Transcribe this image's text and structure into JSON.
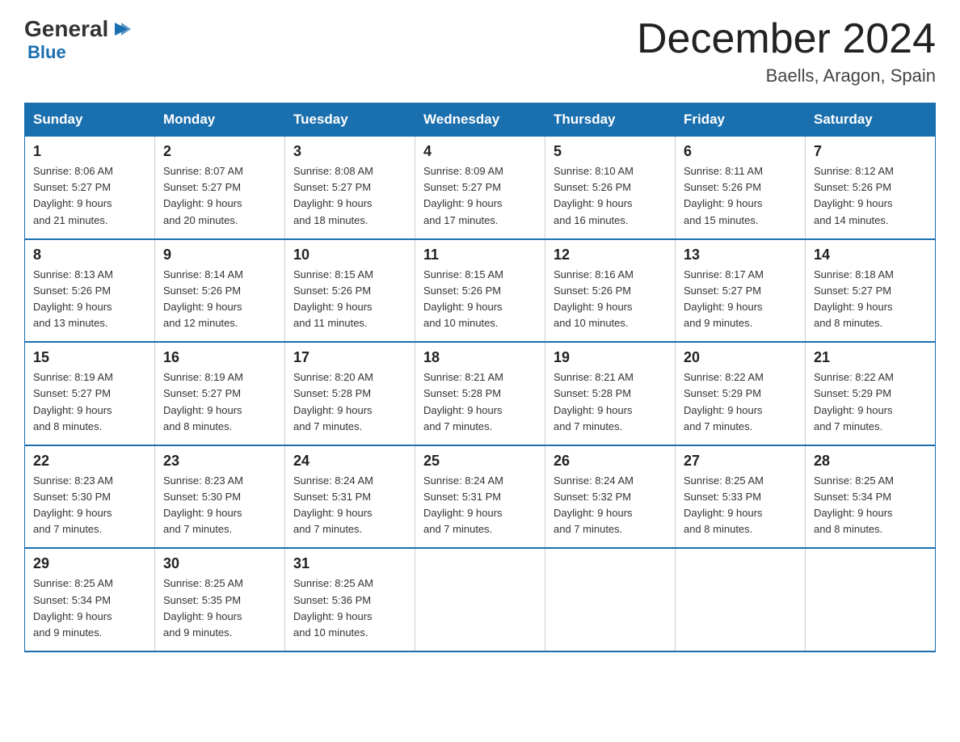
{
  "logo": {
    "general": "General",
    "blue": "Blue"
  },
  "title": "December 2024",
  "subtitle": "Baells, Aragon, Spain",
  "weekdays": [
    "Sunday",
    "Monday",
    "Tuesday",
    "Wednesday",
    "Thursday",
    "Friday",
    "Saturday"
  ],
  "weeks": [
    [
      {
        "day": "1",
        "sunrise": "8:06 AM",
        "sunset": "5:27 PM",
        "daylight": "9 hours and 21 minutes."
      },
      {
        "day": "2",
        "sunrise": "8:07 AM",
        "sunset": "5:27 PM",
        "daylight": "9 hours and 20 minutes."
      },
      {
        "day": "3",
        "sunrise": "8:08 AM",
        "sunset": "5:27 PM",
        "daylight": "9 hours and 18 minutes."
      },
      {
        "day": "4",
        "sunrise": "8:09 AM",
        "sunset": "5:27 PM",
        "daylight": "9 hours and 17 minutes."
      },
      {
        "day": "5",
        "sunrise": "8:10 AM",
        "sunset": "5:26 PM",
        "daylight": "9 hours and 16 minutes."
      },
      {
        "day": "6",
        "sunrise": "8:11 AM",
        "sunset": "5:26 PM",
        "daylight": "9 hours and 15 minutes."
      },
      {
        "day": "7",
        "sunrise": "8:12 AM",
        "sunset": "5:26 PM",
        "daylight": "9 hours and 14 minutes."
      }
    ],
    [
      {
        "day": "8",
        "sunrise": "8:13 AM",
        "sunset": "5:26 PM",
        "daylight": "9 hours and 13 minutes."
      },
      {
        "day": "9",
        "sunrise": "8:14 AM",
        "sunset": "5:26 PM",
        "daylight": "9 hours and 12 minutes."
      },
      {
        "day": "10",
        "sunrise": "8:15 AM",
        "sunset": "5:26 PM",
        "daylight": "9 hours and 11 minutes."
      },
      {
        "day": "11",
        "sunrise": "8:15 AM",
        "sunset": "5:26 PM",
        "daylight": "9 hours and 10 minutes."
      },
      {
        "day": "12",
        "sunrise": "8:16 AM",
        "sunset": "5:26 PM",
        "daylight": "9 hours and 10 minutes."
      },
      {
        "day": "13",
        "sunrise": "8:17 AM",
        "sunset": "5:27 PM",
        "daylight": "9 hours and 9 minutes."
      },
      {
        "day": "14",
        "sunrise": "8:18 AM",
        "sunset": "5:27 PM",
        "daylight": "9 hours and 8 minutes."
      }
    ],
    [
      {
        "day": "15",
        "sunrise": "8:19 AM",
        "sunset": "5:27 PM",
        "daylight": "9 hours and 8 minutes."
      },
      {
        "day": "16",
        "sunrise": "8:19 AM",
        "sunset": "5:27 PM",
        "daylight": "9 hours and 8 minutes."
      },
      {
        "day": "17",
        "sunrise": "8:20 AM",
        "sunset": "5:28 PM",
        "daylight": "9 hours and 7 minutes."
      },
      {
        "day": "18",
        "sunrise": "8:21 AM",
        "sunset": "5:28 PM",
        "daylight": "9 hours and 7 minutes."
      },
      {
        "day": "19",
        "sunrise": "8:21 AM",
        "sunset": "5:28 PM",
        "daylight": "9 hours and 7 minutes."
      },
      {
        "day": "20",
        "sunrise": "8:22 AM",
        "sunset": "5:29 PM",
        "daylight": "9 hours and 7 minutes."
      },
      {
        "day": "21",
        "sunrise": "8:22 AM",
        "sunset": "5:29 PM",
        "daylight": "9 hours and 7 minutes."
      }
    ],
    [
      {
        "day": "22",
        "sunrise": "8:23 AM",
        "sunset": "5:30 PM",
        "daylight": "9 hours and 7 minutes."
      },
      {
        "day": "23",
        "sunrise": "8:23 AM",
        "sunset": "5:30 PM",
        "daylight": "9 hours and 7 minutes."
      },
      {
        "day": "24",
        "sunrise": "8:24 AM",
        "sunset": "5:31 PM",
        "daylight": "9 hours and 7 minutes."
      },
      {
        "day": "25",
        "sunrise": "8:24 AM",
        "sunset": "5:31 PM",
        "daylight": "9 hours and 7 minutes."
      },
      {
        "day": "26",
        "sunrise": "8:24 AM",
        "sunset": "5:32 PM",
        "daylight": "9 hours and 7 minutes."
      },
      {
        "day": "27",
        "sunrise": "8:25 AM",
        "sunset": "5:33 PM",
        "daylight": "9 hours and 8 minutes."
      },
      {
        "day": "28",
        "sunrise": "8:25 AM",
        "sunset": "5:34 PM",
        "daylight": "9 hours and 8 minutes."
      }
    ],
    [
      {
        "day": "29",
        "sunrise": "8:25 AM",
        "sunset": "5:34 PM",
        "daylight": "9 hours and 9 minutes."
      },
      {
        "day": "30",
        "sunrise": "8:25 AM",
        "sunset": "5:35 PM",
        "daylight": "9 hours and 9 minutes."
      },
      {
        "day": "31",
        "sunrise": "8:25 AM",
        "sunset": "5:36 PM",
        "daylight": "9 hours and 10 minutes."
      },
      null,
      null,
      null,
      null
    ]
  ]
}
